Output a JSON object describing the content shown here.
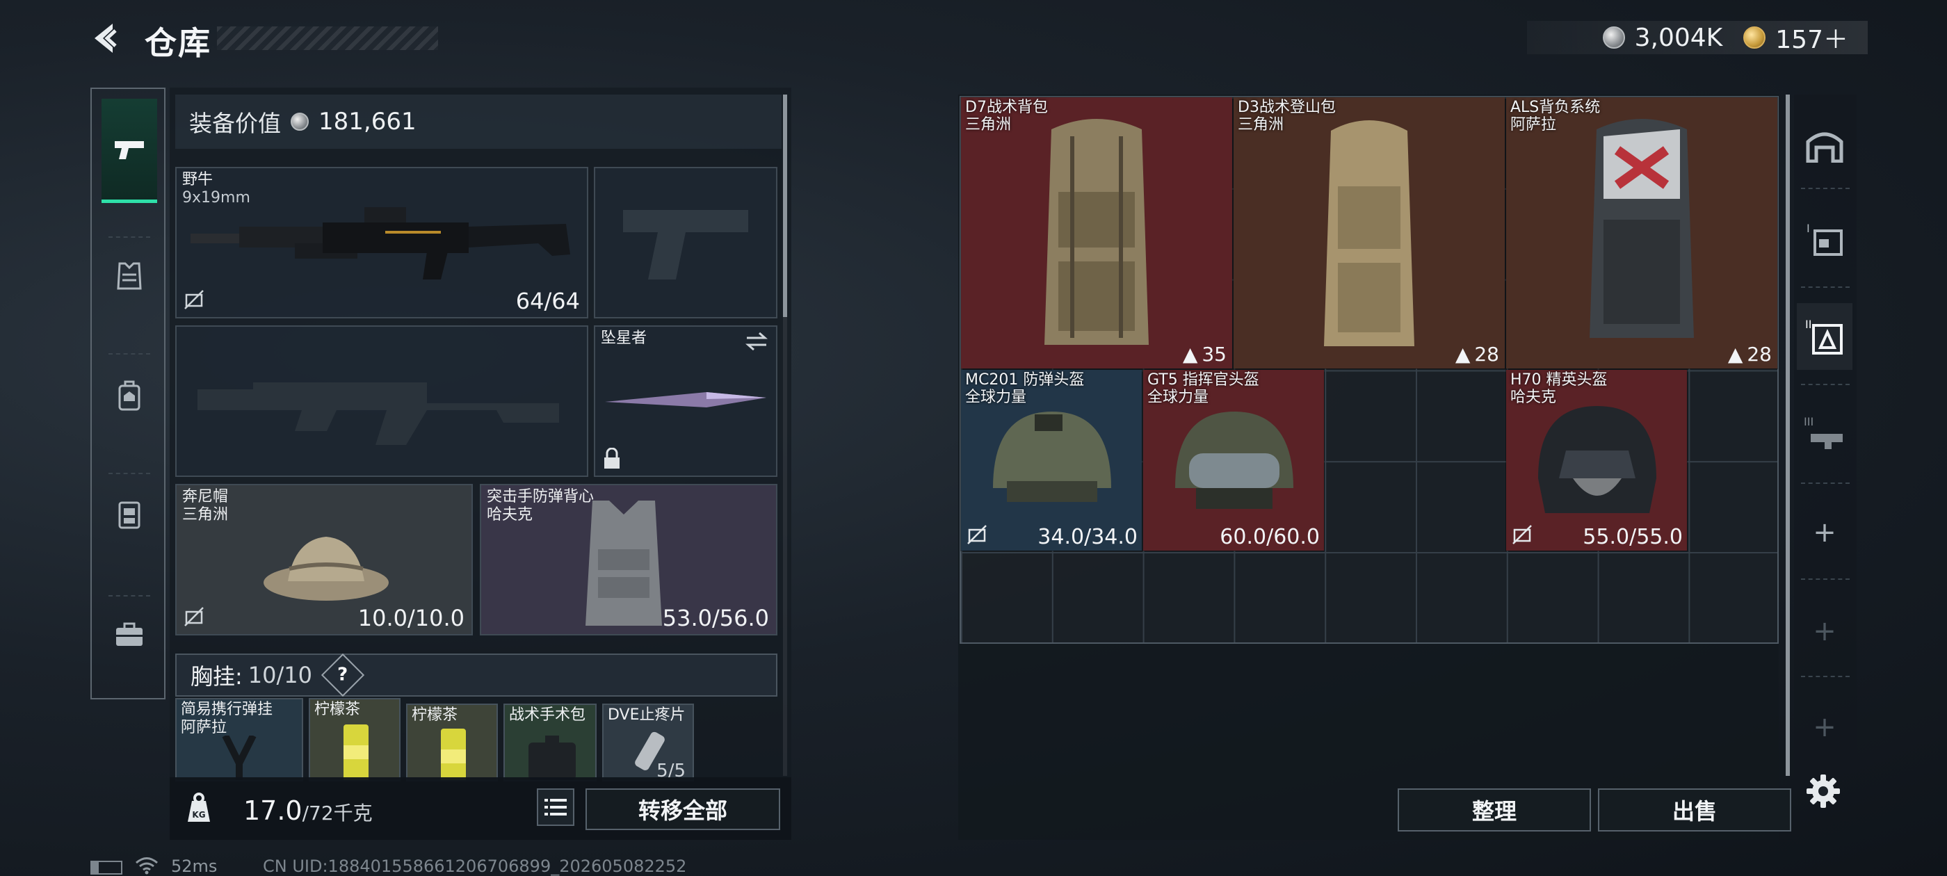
{
  "header": {
    "title": "仓库"
  },
  "currency": [
    {
      "icon": "silver-coin-icon",
      "value": "3,004K"
    },
    {
      "icon": "gold-coin-icon",
      "value": "157＋"
    }
  ],
  "equipment": {
    "value_label": "装备价值",
    "value_amount": "181,661",
    "primary_weapon": {
      "name": "野牛",
      "sub": "9x19mm",
      "ammo": "64/64"
    },
    "melee": {
      "name": "坠星者"
    },
    "helmet": {
      "name": "奔尼帽",
      "brand": "三角洲",
      "durability": "10.0/10.0"
    },
    "armor": {
      "name": "突击手防弹背心",
      "brand": "哈夫克",
      "durability": "53.0/56.0"
    }
  },
  "rig": {
    "label": "胸挂:",
    "count": "10/10",
    "help": "?",
    "items": [
      {
        "name": "简易携行弹挂",
        "brand": "阿萨拉"
      },
      {
        "name": "柠檬茶",
        "brand": ""
      },
      {
        "name": "柠檬茶",
        "brand": ""
      },
      {
        "name": "战术手术包",
        "brand": ""
      },
      {
        "name": "DVE止疼片",
        "brand": "",
        "count": "5/5"
      }
    ]
  },
  "weight": {
    "current": "17.0",
    "max": "/72千克"
  },
  "buttons": {
    "transfer_all": "转移全部",
    "sort": "整理",
    "sell": "出售"
  },
  "status": {
    "ping": "52ms",
    "uid": "CN UID:18840155866120670689​9_202605082252"
  },
  "stash": {
    "backpacks": [
      {
        "name": "D7战术背包",
        "brand": "三角洲",
        "capacity": "35",
        "color": "#5a2226"
      },
      {
        "name": "D3战术登山包",
        "brand": "三角洲",
        "capacity": "28",
        "color": "#4a2e24"
      },
      {
        "name": "ALS背负系统",
        "brand": "阿萨拉",
        "capacity": "28",
        "color": "#4a2e24"
      }
    ],
    "helmets": [
      {
        "name": "MC201 防弹头盔",
        "brand": "全球力量",
        "durability": "34.0/34.0",
        "color": "#223648"
      },
      {
        "name": "GT5 指挥官头盔",
        "brand": "全球力量",
        "durability": "60.0/60.0",
        "color": "#5a2226"
      },
      {
        "name": "H70 精英头盔",
        "brand": "哈夫克",
        "durability": "55.0/55.0",
        "color": "#5a2226"
      }
    ]
  },
  "right_nav": [
    "warehouse-icon",
    "storage-1-icon",
    "storage-2-icon",
    "storage-3-icon",
    "add",
    "add",
    "add"
  ]
}
